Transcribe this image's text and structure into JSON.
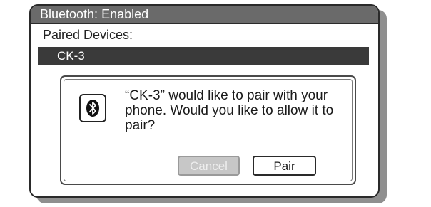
{
  "window": {
    "title": "Bluetooth: Enabled"
  },
  "paired": {
    "label": "Paired Devices:",
    "devices": [
      "CK-3"
    ]
  },
  "dialog": {
    "icon": "bluetooth-icon",
    "message": "“CK-3” would like to pair with your phone. Would you like to allow it to pair?",
    "cancel_label": "Cancel",
    "pair_label": "Pair"
  },
  "colors": {
    "title_bar": "#6a6a6a",
    "selected_row": "#3a3a3a",
    "disabled_button": "#c7c7c7"
  }
}
